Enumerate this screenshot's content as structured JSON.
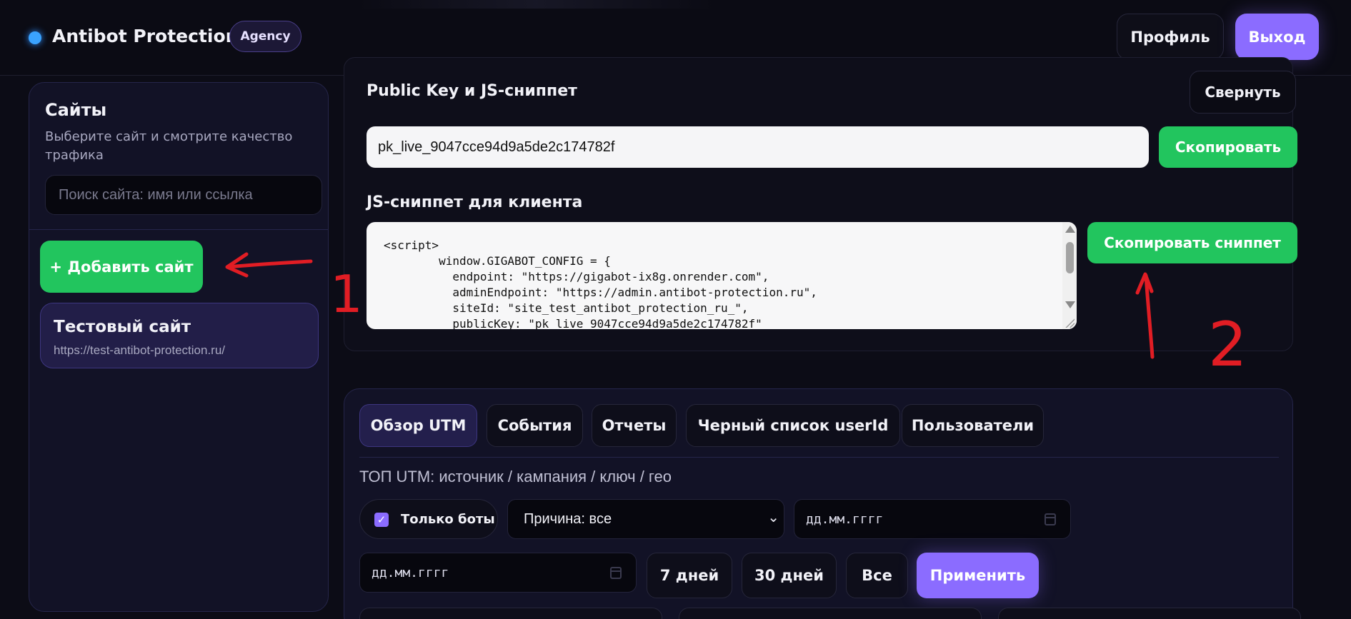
{
  "header": {
    "brand": "Antibot Protection",
    "badge": "Agency",
    "profile": "Профиль",
    "logout": "Выход"
  },
  "sidebar": {
    "title": "Сайты",
    "subtitle": "Выберите сайт и смотрите качество трафика",
    "search_placeholder": "Поиск сайта: имя или ссылка",
    "add_site": "+ Добавить сайт",
    "sites": [
      {
        "name": "Тестовый сайт",
        "url": "https://test-antibot-protection.ru/"
      }
    ]
  },
  "key_panel": {
    "title": "Public Key и JS-сниппет",
    "collapse": "Свернуть",
    "public_key": "pk_live_9047cce94d9a5de2c174782f",
    "copy": "Скопировать",
    "snippet_title": "JS-сниппет для клиента",
    "snippet_code": "<script>\n        window.GIGABOT_CONFIG = {\n          endpoint: \"https://gigabot-ix8g.onrender.com\",\n          adminEndpoint: \"https://admin.antibot-protection.ru\",\n          siteId: \"site_test_antibot_protection_ru_\",\n          publicKey: \"pk_live_9047cce94d9a5de2c174782f\"",
    "copy_snippet": "Скопировать сниппет"
  },
  "analytics": {
    "tabs": [
      {
        "label": "Обзор UTM",
        "active": true
      },
      {
        "label": "События",
        "active": false
      },
      {
        "label": "Отчеты",
        "active": false
      },
      {
        "label": "Черный список userId",
        "active": false
      },
      {
        "label": "Пользователи",
        "active": false
      }
    ],
    "heading": "ТОП UTM: источник / кампания / ключ / гео",
    "only_bots": {
      "label": "Только боты",
      "checked": true
    },
    "reason": "Причина: все",
    "date_placeholder": "дд.мм.гггг",
    "ranges": [
      "7 дней",
      "30 дней",
      "Все"
    ],
    "apply": "Применить"
  },
  "annotations": {
    "mark_1": "1",
    "mark_2": "2",
    "color": "#e11d24"
  },
  "colors": {
    "accent": "#8b6cff",
    "success": "#22c55e",
    "background": "#0c0c16"
  }
}
